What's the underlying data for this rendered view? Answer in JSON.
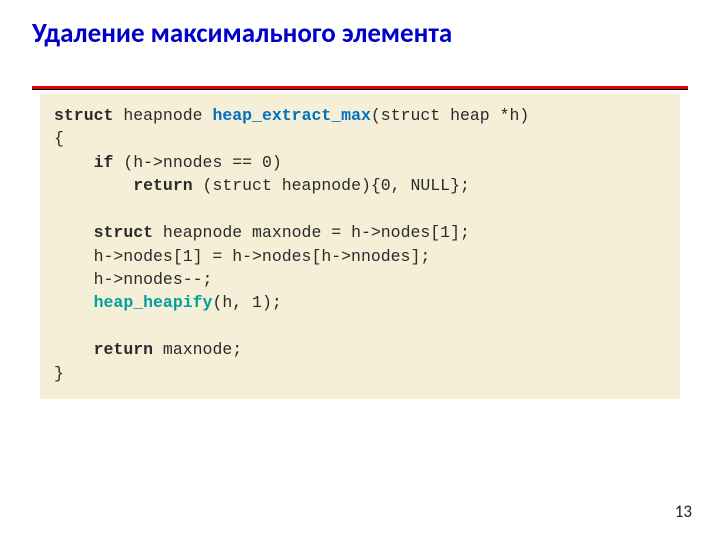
{
  "title": "Удаление максимального элемента",
  "page_number": "13",
  "code": {
    "l1": {
      "kw1": "struct",
      "t1": " heapnode ",
      "fn": "heap_extract_max",
      "t2": "(struct heap *h)"
    },
    "l2": "{",
    "l3": {
      "pad": "    ",
      "kw": "if",
      "t": " (h->nnodes == 0)"
    },
    "l4": {
      "pad": "        ",
      "kw": "return",
      "t": " (struct heapnode){0, NULL};"
    },
    "l5": "",
    "l6": {
      "pad": "    ",
      "kw": "struct",
      "t": " heapnode maxnode = h->nodes[1];"
    },
    "l7": "    h->nodes[1] = h->nodes[h->nnodes];",
    "l8": "    h->nnodes--;",
    "l9": {
      "pad": "    ",
      "call": "heap_heapify",
      "t": "(h, 1);"
    },
    "l10": "",
    "l11": {
      "pad": "    ",
      "kw": "return",
      "t": " maxnode;"
    },
    "l12": "}"
  }
}
